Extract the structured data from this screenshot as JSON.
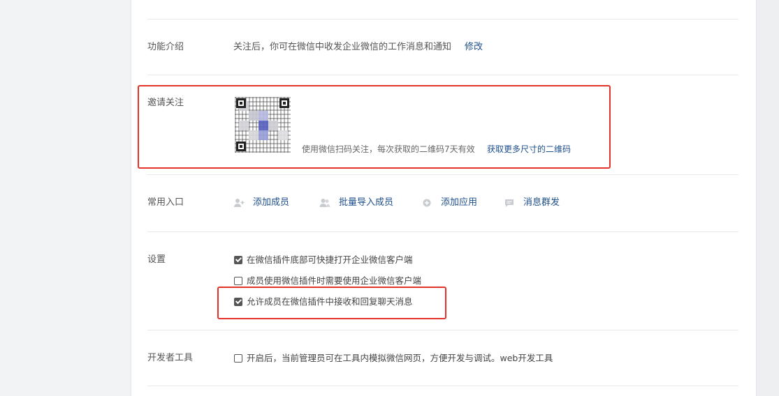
{
  "intro": {
    "label": "功能介绍",
    "text": "关注后，你可在微信中收发企业微信的工作消息和通知",
    "edit_link": "修改"
  },
  "invite": {
    "label": "邀请关注",
    "qr_desc": "使用微信扫码关注，每次获取的二维码7天有效",
    "more_sizes_link": "获取更多尺寸的二维码"
  },
  "common_entries": {
    "label": "常用入口",
    "items": [
      {
        "icon": "add-person-icon",
        "label": "添加成员"
      },
      {
        "icon": "people-icon",
        "label": "批量导入成员"
      },
      {
        "icon": "plus-circle-icon",
        "label": "添加应用"
      },
      {
        "icon": "message-icon",
        "label": "消息群发"
      }
    ]
  },
  "settings": {
    "label": "设置",
    "options": [
      {
        "label": "在微信插件底部可快捷打开企业微信客户端",
        "checked": true
      },
      {
        "label": "成员使用微信插件时需要使用企业微信客户端",
        "checked": false
      },
      {
        "label": "允许成员在微信插件中接收和回复聊天消息",
        "checked": true
      }
    ]
  },
  "dev_tools": {
    "label": "开发者工具",
    "text": "开启后，当前管理员可在工具内模拟微信网页，方便开发与调试。",
    "link": "web开发工具",
    "checked": false
  },
  "colors": {
    "link": "#1e4f8a",
    "annotation": "#e3322a",
    "divider": "#e8e9eb"
  }
}
